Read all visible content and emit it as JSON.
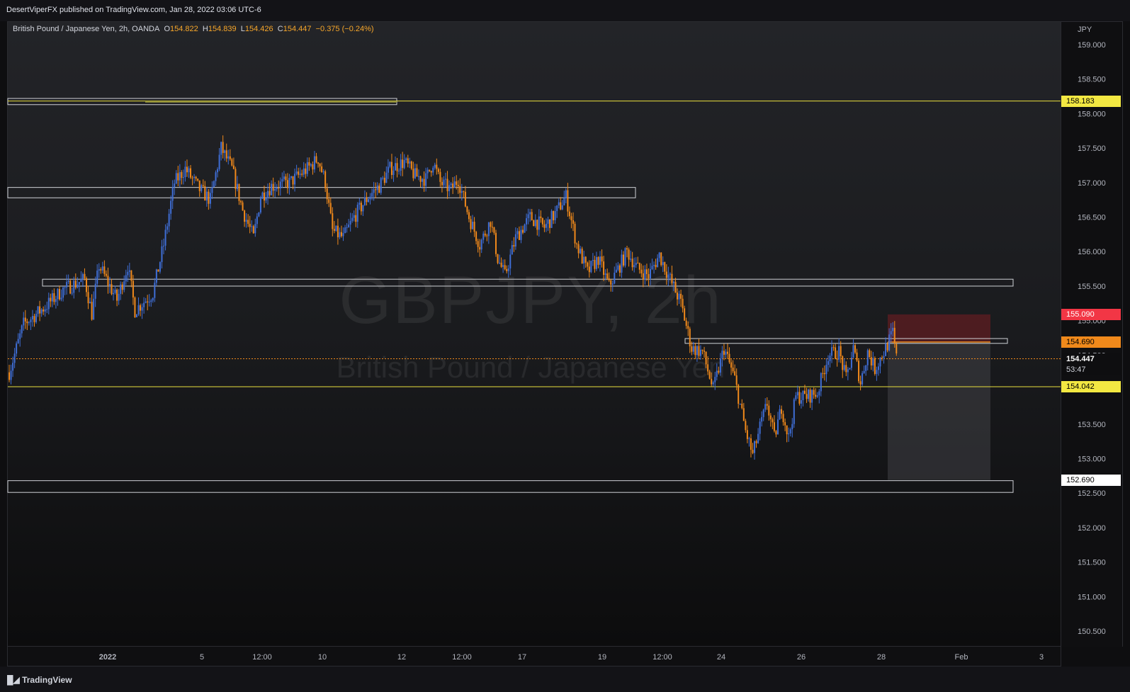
{
  "header": {
    "published": "DesertViperFX published on TradingView.com, Jan 28, 2022 03:06 UTC-6"
  },
  "legend": {
    "symbol": "British Pound / Japanese Yen, 2h, OANDA",
    "o_label": "O",
    "o_value": "154.822",
    "h_label": "H",
    "h_value": "154.839",
    "l_label": "L",
    "l_value": "154.426",
    "c_label": "C",
    "c_value": "154.447",
    "change": "−0.375 (−0.24%)"
  },
  "watermark": {
    "ticker": "GBPJPY, 2h",
    "name": "British Pound / Japanese Yen"
  },
  "footer": {
    "brand": "TradingView"
  },
  "colors": {
    "up": "#3f6ed6",
    "down": "#f0891b",
    "level": "#e8e03c",
    "stop": "#f23645"
  },
  "chart_data": {
    "type": "candlestick",
    "currency": "JPY",
    "ylim": [
      150.4,
      159.4
    ],
    "y_ticks": [
      "159.000",
      "158.500",
      "158.000",
      "157.500",
      "157.000",
      "156.500",
      "156.000",
      "155.500",
      "155.000",
      "154.500",
      "154.000",
      "153.500",
      "153.000",
      "152.500",
      "152.000",
      "151.500",
      "151.000",
      "150.500"
    ],
    "x_ticks": [
      "2022",
      "5",
      "12:00",
      "10",
      "12",
      "12:00",
      "17",
      "19",
      "12:00",
      "24",
      "26",
      "28",
      "Feb",
      "3"
    ],
    "price_tags": [
      {
        "label": "158.183",
        "value": 158.183,
        "style": "level"
      },
      {
        "label": "155.090",
        "value": 155.09,
        "style": "stop"
      },
      {
        "label": "154.690",
        "value": 154.69,
        "style": "entry"
      },
      {
        "label": "154.447",
        "value": 154.447,
        "style": "last",
        "countdown": "53:47"
      },
      {
        "label": "154.042",
        "value": 154.042,
        "style": "level"
      },
      {
        "label": "152.690",
        "value": 152.69,
        "style": "target"
      }
    ],
    "horizontal_levels": [
      158.183,
      154.042
    ],
    "zones": [
      {
        "top": 158.22,
        "bottom": 158.13
      },
      {
        "top": 156.93,
        "bottom": 156.78
      },
      {
        "top": 155.6,
        "bottom": 155.5
      },
      {
        "top": 154.74,
        "bottom": 154.67
      },
      {
        "top": 152.68,
        "bottom": 152.51
      }
    ],
    "position": {
      "entry": 154.69,
      "stop": 155.09,
      "target": 152.69
    },
    "anchors": [
      {
        "i": 0,
        "p": 154.25
      },
      {
        "i": 8,
        "p": 154.95
      },
      {
        "i": 20,
        "p": 155.2
      },
      {
        "i": 30,
        "p": 155.45
      },
      {
        "i": 42,
        "p": 155.6
      },
      {
        "i": 46,
        "p": 155.1
      },
      {
        "i": 50,
        "p": 155.8
      },
      {
        "i": 60,
        "p": 155.3
      },
      {
        "i": 66,
        "p": 155.8
      },
      {
        "i": 70,
        "p": 155.15
      },
      {
        "i": 80,
        "p": 155.4
      },
      {
        "i": 86,
        "p": 156.1
      },
      {
        "i": 92,
        "p": 157.0
      },
      {
        "i": 98,
        "p": 157.2
      },
      {
        "i": 106,
        "p": 156.9
      },
      {
        "i": 112,
        "p": 156.75
      },
      {
        "i": 118,
        "p": 157.5
      },
      {
        "i": 124,
        "p": 157.2
      },
      {
        "i": 130,
        "p": 156.6
      },
      {
        "i": 136,
        "p": 156.2
      },
      {
        "i": 140,
        "p": 156.8
      },
      {
        "i": 146,
        "p": 156.95
      },
      {
        "i": 156,
        "p": 157.0
      },
      {
        "i": 166,
        "p": 157.2
      },
      {
        "i": 172,
        "p": 157.35
      },
      {
        "i": 176,
        "p": 157.0
      },
      {
        "i": 180,
        "p": 156.3
      },
      {
        "i": 186,
        "p": 156.2
      },
      {
        "i": 192,
        "p": 156.5
      },
      {
        "i": 200,
        "p": 156.8
      },
      {
        "i": 206,
        "p": 156.95
      },
      {
        "i": 212,
        "p": 157.2
      },
      {
        "i": 220,
        "p": 157.3
      },
      {
        "i": 226,
        "p": 157.1
      },
      {
        "i": 232,
        "p": 157.05
      },
      {
        "i": 236,
        "p": 157.3
      },
      {
        "i": 240,
        "p": 157.0
      },
      {
        "i": 246,
        "p": 156.9
      },
      {
        "i": 250,
        "p": 157.05
      },
      {
        "i": 256,
        "p": 156.5
      },
      {
        "i": 262,
        "p": 156.1
      },
      {
        "i": 268,
        "p": 156.45
      },
      {
        "i": 272,
        "p": 155.9
      },
      {
        "i": 276,
        "p": 155.65
      },
      {
        "i": 282,
        "p": 156.2
      },
      {
        "i": 290,
        "p": 156.5
      },
      {
        "i": 298,
        "p": 156.35
      },
      {
        "i": 304,
        "p": 156.55
      },
      {
        "i": 310,
        "p": 156.8
      },
      {
        "i": 316,
        "p": 156.1
      },
      {
        "i": 322,
        "p": 155.7
      },
      {
        "i": 328,
        "p": 155.9
      },
      {
        "i": 334,
        "p": 155.5
      },
      {
        "i": 338,
        "p": 155.7
      },
      {
        "i": 344,
        "p": 156.0
      },
      {
        "i": 350,
        "p": 155.75
      },
      {
        "i": 356,
        "p": 155.65
      },
      {
        "i": 362,
        "p": 155.95
      },
      {
        "i": 368,
        "p": 155.6
      },
      {
        "i": 374,
        "p": 155.25
      },
      {
        "i": 380,
        "p": 154.6
      },
      {
        "i": 386,
        "p": 154.55
      },
      {
        "i": 392,
        "p": 154.0
      },
      {
        "i": 398,
        "p": 154.6
      },
      {
        "i": 404,
        "p": 154.15
      },
      {
        "i": 410,
        "p": 153.4
      },
      {
        "i": 414,
        "p": 153.05
      },
      {
        "i": 418,
        "p": 153.45
      },
      {
        "i": 422,
        "p": 153.8
      },
      {
        "i": 426,
        "p": 153.3
      },
      {
        "i": 430,
        "p": 153.75
      },
      {
        "i": 434,
        "p": 153.3
      },
      {
        "i": 438,
        "p": 153.9
      },
      {
        "i": 444,
        "p": 153.9
      },
      {
        "i": 450,
        "p": 153.95
      },
      {
        "i": 456,
        "p": 154.5
      },
      {
        "i": 462,
        "p": 154.55
      },
      {
        "i": 466,
        "p": 154.15
      },
      {
        "i": 470,
        "p": 154.6
      },
      {
        "i": 474,
        "p": 154.1
      },
      {
        "i": 478,
        "p": 154.55
      },
      {
        "i": 482,
        "p": 154.3
      },
      {
        "i": 488,
        "p": 154.6
      },
      {
        "i": 492,
        "p": 154.82
      },
      {
        "i": 494,
        "p": 154.447
      }
    ]
  }
}
